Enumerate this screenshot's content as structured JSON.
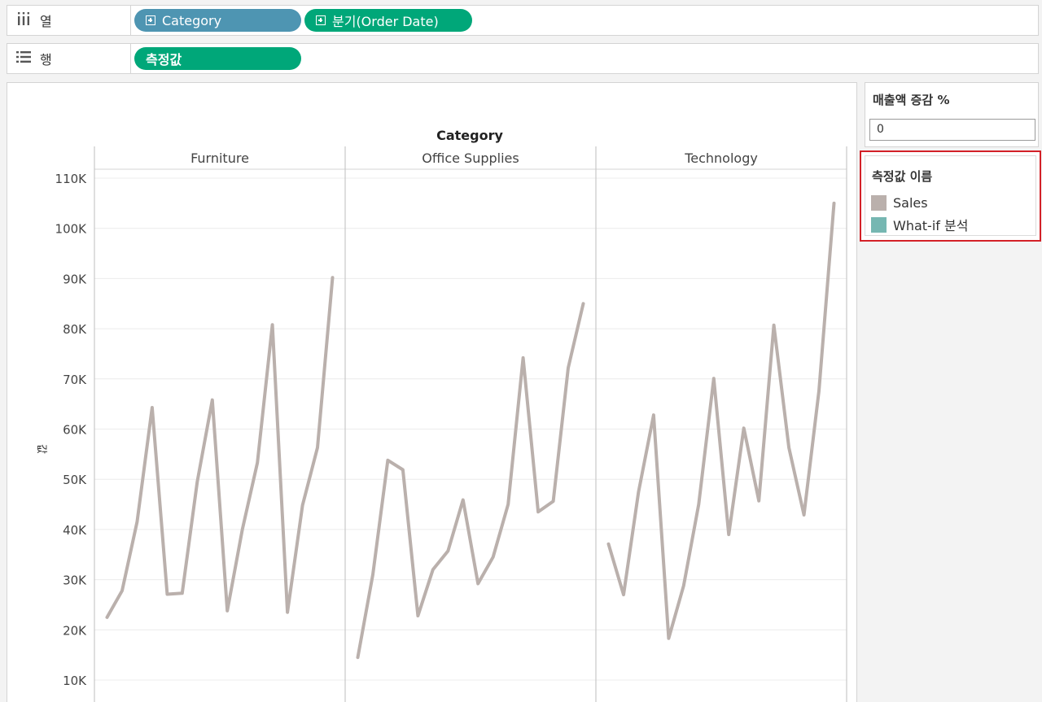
{
  "shelves": {
    "columns": {
      "label": "열",
      "icon": "columns-icon",
      "pills": [
        {
          "text": "Category",
          "color": "#4e95b2"
        },
        {
          "text": "분기(Order Date)",
          "color": "#00a779"
        }
      ]
    },
    "rows": {
      "label": "행",
      "icon": "rows-icon",
      "pills": [
        {
          "text": "측정값",
          "color": "#00a779"
        }
      ]
    }
  },
  "parameter": {
    "title": "매출액 증감 %",
    "value": "0"
  },
  "legend": {
    "title": "측정값 이름",
    "items": [
      {
        "label": "Sales",
        "color": "#bab0ac"
      },
      {
        "label": "What-if 분석",
        "color": "#76b7b2"
      }
    ]
  },
  "chart_data": {
    "type": "line",
    "title": "Category",
    "ylabel": "값",
    "ylim": [
      5000,
      112500
    ],
    "y_ticks": [
      10000,
      20000,
      30000,
      40000,
      50000,
      60000,
      70000,
      80000,
      90000,
      100000,
      110000
    ],
    "y_tick_labels": [
      "10K",
      "20K",
      "30K",
      "40K",
      "50K",
      "60K",
      "70K",
      "80K",
      "90K",
      "100K",
      "110K"
    ],
    "grid": true,
    "line_color": "#bab0ac",
    "panels": [
      {
        "category": "Furniture",
        "series": [
          {
            "name": "Sales",
            "values": [
              22500,
              27800,
              41500,
              64300,
              27100,
              27300,
              49500,
              65800,
              23800,
              40000,
              53300,
              80800,
              23500,
              44800,
              56300,
              90200
            ]
          }
        ]
      },
      {
        "category": "Office Supplies",
        "series": [
          {
            "name": "Sales",
            "values": [
              14500,
              31000,
              53800,
              51900,
              22800,
              32000,
              35700,
              45900,
              29200,
              34500,
              45000,
              74200,
              43500,
              45600,
              72200,
              85000
            ]
          }
        ]
      },
      {
        "category": "Technology",
        "series": [
          {
            "name": "Sales",
            "values": [
              37100,
              27000,
              47500,
              62800,
              18300,
              28800,
              45000,
              70100,
              39000,
              60200,
              45700,
              80700,
              56300,
              42900,
              67600,
              105000
            ]
          }
        ]
      }
    ]
  }
}
